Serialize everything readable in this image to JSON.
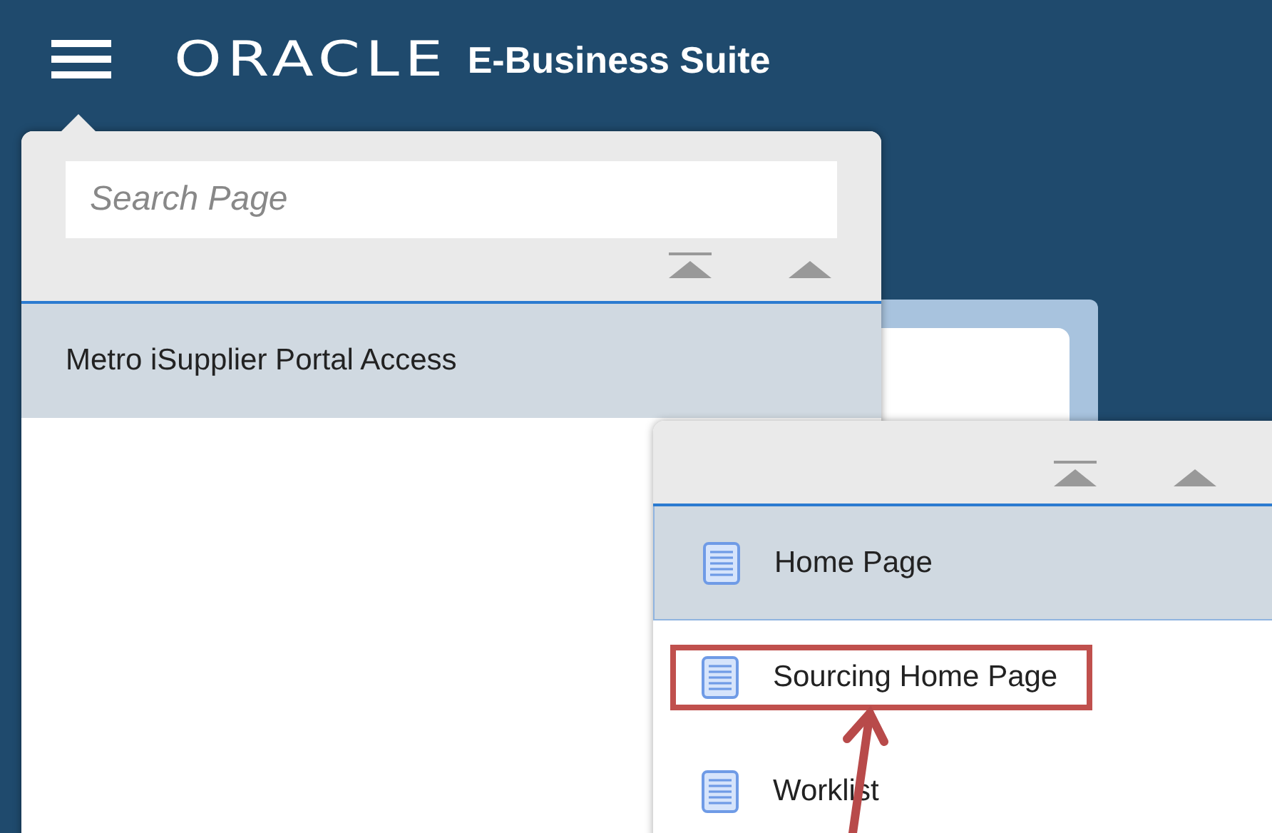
{
  "header": {
    "logo": "ORACLE",
    "product": "E-Business Suite"
  },
  "navigator": {
    "search": {
      "placeholder": "Search Page"
    },
    "items": [
      {
        "label": "Metro iSupplier Portal Access",
        "selected": true
      }
    ]
  },
  "submenu": {
    "items": [
      {
        "label": "Home Page",
        "selected": true,
        "highlighted": false
      },
      {
        "label": "Sourcing Home Page",
        "selected": false,
        "highlighted": true
      },
      {
        "label": "Worklist",
        "selected": false,
        "highlighted": false
      }
    ]
  }
}
